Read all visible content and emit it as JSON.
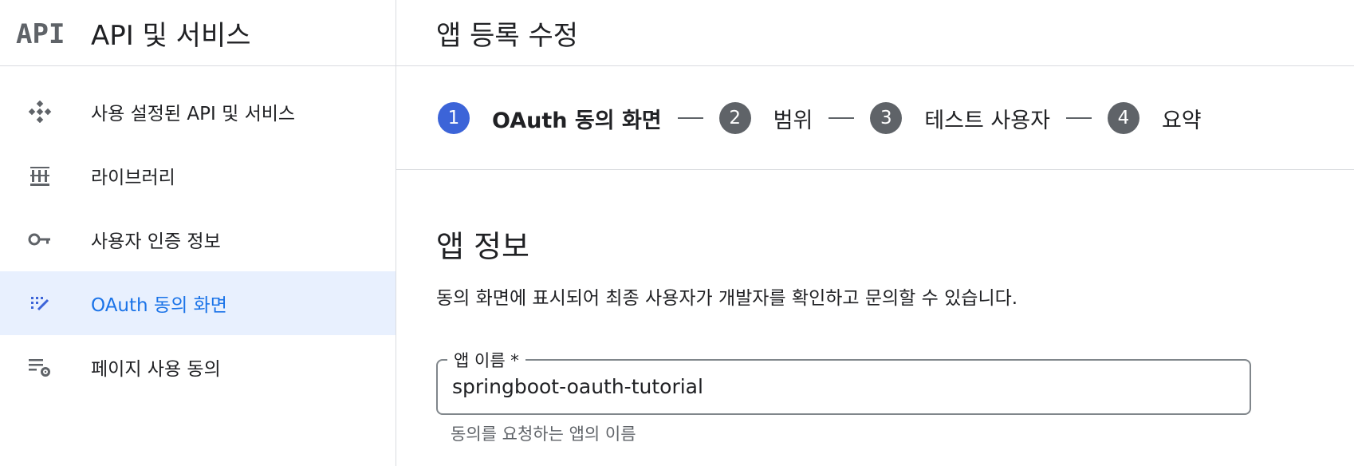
{
  "sidebar": {
    "title": "API 및 서비스",
    "logo_text": "API",
    "items": [
      {
        "label": "사용 설정된 API 및 서비스",
        "icon": "api-diamond-icon",
        "active": false
      },
      {
        "label": "라이브러리",
        "icon": "library-icon",
        "active": false
      },
      {
        "label": "사용자 인증 정보",
        "icon": "key-icon",
        "active": false
      },
      {
        "label": "OAuth 동의 화면",
        "icon": "oauth-consent-icon",
        "active": true
      },
      {
        "label": "페이지 사용 동의",
        "icon": "page-usage-settings-icon",
        "active": false
      }
    ]
  },
  "header": {
    "title": "앱 등록 수정"
  },
  "stepper": {
    "steps": [
      {
        "number": "1",
        "label": "OAuth 동의 화면",
        "active": true
      },
      {
        "number": "2",
        "label": "범위",
        "active": false
      },
      {
        "number": "3",
        "label": "테스트 사용자",
        "active": false
      },
      {
        "number": "4",
        "label": "요약",
        "active": false
      }
    ]
  },
  "app_info": {
    "title": "앱 정보",
    "description": "동의 화면에 표시되어 최종 사용자가 개발자를 확인하고 문의할 수 있습니다.",
    "app_name_label": "앱 이름 *",
    "app_name_value": "springboot-oauth-tutorial",
    "app_name_hint": "동의를 요청하는 앱의 이름"
  },
  "colors": {
    "accent": "#1a73e8",
    "active_bg": "#e8f0fe",
    "step_active": "#3c64d8",
    "step_inactive": "#5f6368"
  }
}
